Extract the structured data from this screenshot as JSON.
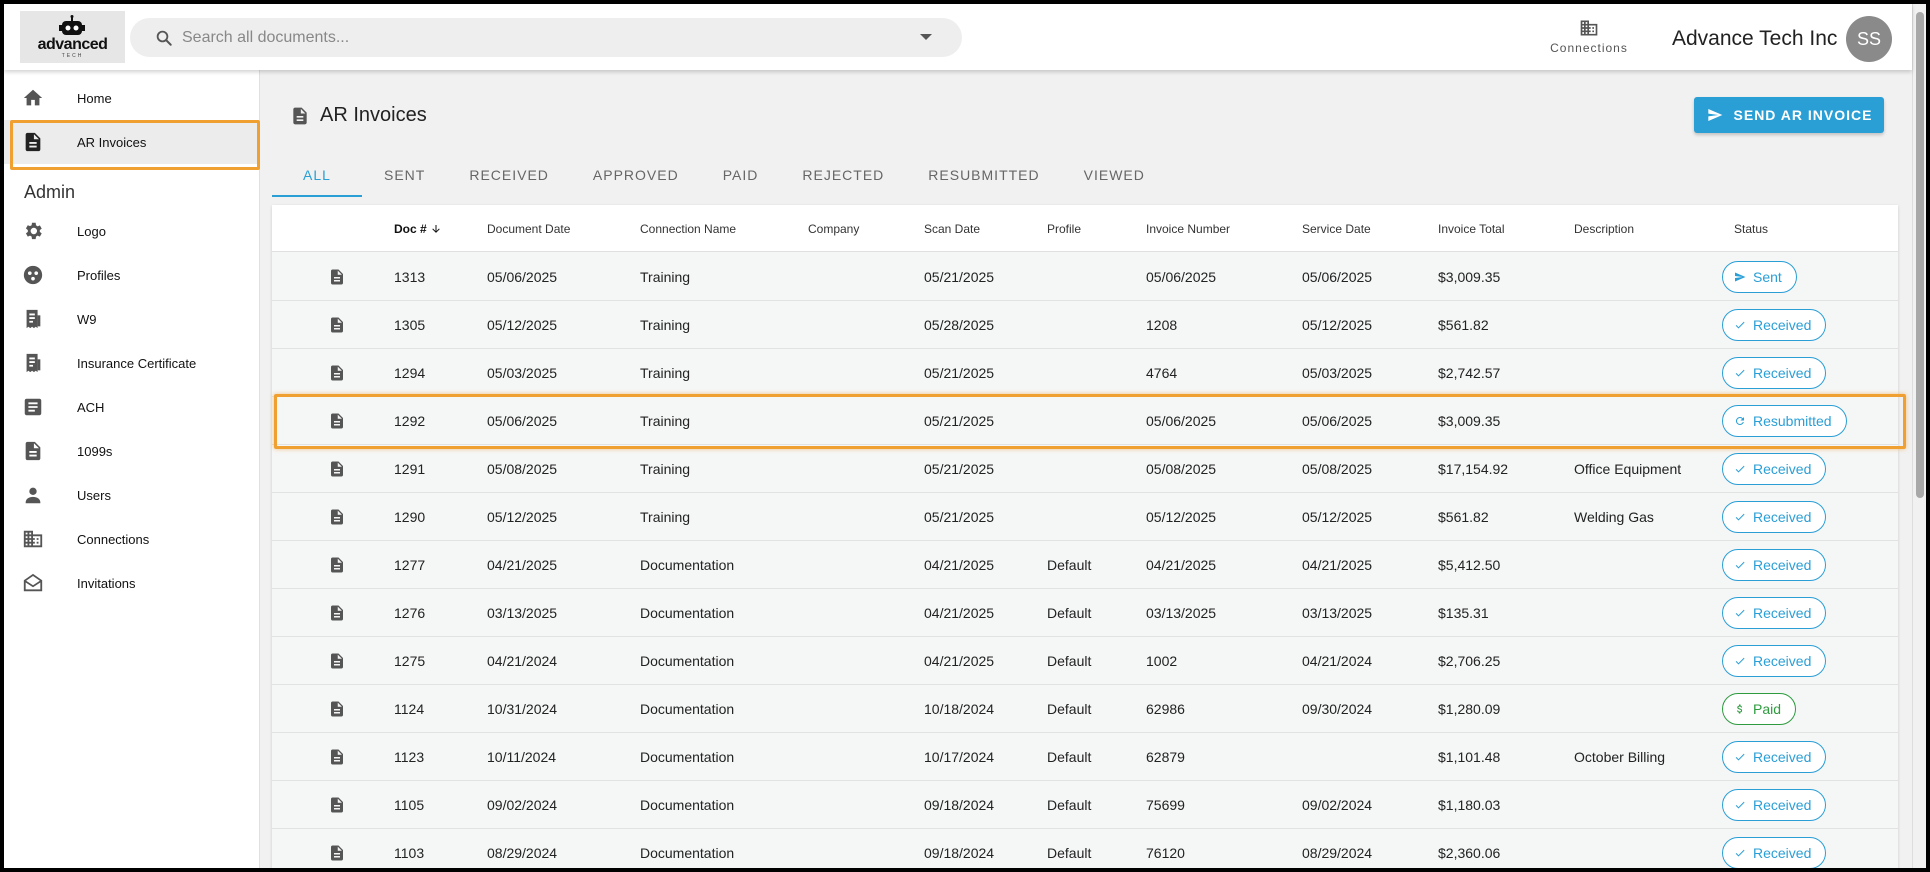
{
  "header": {
    "logo_text": "advanced",
    "logo_sub": "TECH",
    "search_placeholder": "Search all documents...",
    "connections_label": "Connections",
    "company_name": "Advance Tech Inc",
    "avatar_initials": "SS"
  },
  "sidebar": {
    "items": [
      {
        "label": "Home",
        "icon": "home-icon"
      },
      {
        "label": "AR Invoices",
        "icon": "document-icon",
        "active": true
      }
    ],
    "admin_heading": "Admin",
    "admin_items": [
      {
        "label": "Logo",
        "icon": "gear-icon"
      },
      {
        "label": "Profiles",
        "icon": "profile-icon"
      },
      {
        "label": "W9",
        "icon": "receipt-icon"
      },
      {
        "label": "Insurance Certificate",
        "icon": "receipt-icon"
      },
      {
        "label": "ACH",
        "icon": "article-icon"
      },
      {
        "label": "1099s",
        "icon": "document-icon"
      },
      {
        "label": "Users",
        "icon": "person-icon"
      },
      {
        "label": "Connections",
        "icon": "building-icon"
      },
      {
        "label": "Invitations",
        "icon": "envelope-icon"
      }
    ]
  },
  "main": {
    "title": "AR Invoices",
    "send_button": "SEND AR INVOICE",
    "tabs": [
      "ALL",
      "SENT",
      "RECEIVED",
      "APPROVED",
      "PAID",
      "REJECTED",
      "RESUBMITTED",
      "VIEWED"
    ],
    "active_tab": "ALL"
  },
  "table": {
    "columns": [
      "Doc #",
      "Document Date",
      "Connection Name",
      "Company",
      "Scan Date",
      "Profile",
      "Invoice Number",
      "Service Date",
      "Invoice Total",
      "Description",
      "Status"
    ],
    "sort_column": "Doc #",
    "rows": [
      {
        "doc": "1313",
        "doc_date": "05/06/2025",
        "connection": "Training",
        "company": "",
        "scan": "05/21/2025",
        "profile": "",
        "invoice": "05/06/2025",
        "service": "05/06/2025",
        "total": "$3,009.35",
        "desc": "",
        "status": "Sent",
        "status_icon": "send-icon"
      },
      {
        "doc": "1305",
        "doc_date": "05/12/2025",
        "connection": "Training",
        "company": "",
        "scan": "05/28/2025",
        "profile": "",
        "invoice": "1208",
        "service": "05/12/2025",
        "total": "$561.82",
        "desc": "",
        "status": "Received",
        "status_icon": "check-icon"
      },
      {
        "doc": "1294",
        "doc_date": "05/03/2025",
        "connection": "Training",
        "company": "",
        "scan": "05/21/2025",
        "profile": "",
        "invoice": "4764",
        "service": "05/03/2025",
        "total": "$2,742.57",
        "desc": "",
        "status": "Received",
        "status_icon": "check-icon"
      },
      {
        "doc": "1292",
        "doc_date": "05/06/2025",
        "connection": "Training",
        "company": "",
        "scan": "05/21/2025",
        "profile": "",
        "invoice": "05/06/2025",
        "service": "05/06/2025",
        "total": "$3,009.35",
        "desc": "",
        "status": "Resubmitted",
        "status_icon": "refresh-icon",
        "highlighted": true
      },
      {
        "doc": "1291",
        "doc_date": "05/08/2025",
        "connection": "Training",
        "company": "",
        "scan": "05/21/2025",
        "profile": "",
        "invoice": "05/08/2025",
        "service": "05/08/2025",
        "total": "$17,154.92",
        "desc": "Office Equipment",
        "status": "Received",
        "status_icon": "check-icon"
      },
      {
        "doc": "1290",
        "doc_date": "05/12/2025",
        "connection": "Training",
        "company": "",
        "scan": "05/21/2025",
        "profile": "",
        "invoice": "05/12/2025",
        "service": "05/12/2025",
        "total": "$561.82",
        "desc": "Welding Gas",
        "status": "Received",
        "status_icon": "check-icon"
      },
      {
        "doc": "1277",
        "doc_date": "04/21/2025",
        "connection": "Documentation",
        "company": "",
        "scan": "04/21/2025",
        "profile": "Default",
        "invoice": "04/21/2025",
        "service": "04/21/2025",
        "total": "$5,412.50",
        "desc": "",
        "status": "Received",
        "status_icon": "check-icon"
      },
      {
        "doc": "1276",
        "doc_date": "03/13/2025",
        "connection": "Documentation",
        "company": "",
        "scan": "04/21/2025",
        "profile": "Default",
        "invoice": "03/13/2025",
        "service": "03/13/2025",
        "total": "$135.31",
        "desc": "",
        "status": "Received",
        "status_icon": "check-icon"
      },
      {
        "doc": "1275",
        "doc_date": "04/21/2024",
        "connection": "Documentation",
        "company": "",
        "scan": "04/21/2025",
        "profile": "Default",
        "invoice": "1002",
        "service": "04/21/2024",
        "total": "$2,706.25",
        "desc": "",
        "status": "Received",
        "status_icon": "check-icon"
      },
      {
        "doc": "1124",
        "doc_date": "10/31/2024",
        "connection": "Documentation",
        "company": "",
        "scan": "10/18/2024",
        "profile": "Default",
        "invoice": "62986",
        "service": "09/30/2024",
        "total": "$1,280.09",
        "desc": "",
        "status": "Paid",
        "status_icon": "dollar-icon"
      },
      {
        "doc": "1123",
        "doc_date": "10/11/2024",
        "connection": "Documentation",
        "company": "",
        "scan": "10/17/2024",
        "profile": "Default",
        "invoice": "62879",
        "service": "",
        "total": "$1,101.48",
        "desc": "October Billing",
        "status": "Received",
        "status_icon": "check-icon"
      },
      {
        "doc": "1105",
        "doc_date": "09/02/2024",
        "connection": "Documentation",
        "company": "",
        "scan": "09/18/2024",
        "profile": "Default",
        "invoice": "75699",
        "service": "09/02/2024",
        "total": "$1,180.03",
        "desc": "",
        "status": "Received",
        "status_icon": "check-icon"
      },
      {
        "doc": "1103",
        "doc_date": "08/29/2024",
        "connection": "Documentation",
        "company": "",
        "scan": "09/18/2024",
        "profile": "Default",
        "invoice": "76120",
        "service": "08/29/2024",
        "total": "$2,360.06",
        "desc": "",
        "status": "Received",
        "status_icon": "check-icon"
      }
    ]
  },
  "colors": {
    "accent": "#2a9fd6",
    "paid": "#2e9b3f",
    "highlight": "#f0a030"
  }
}
